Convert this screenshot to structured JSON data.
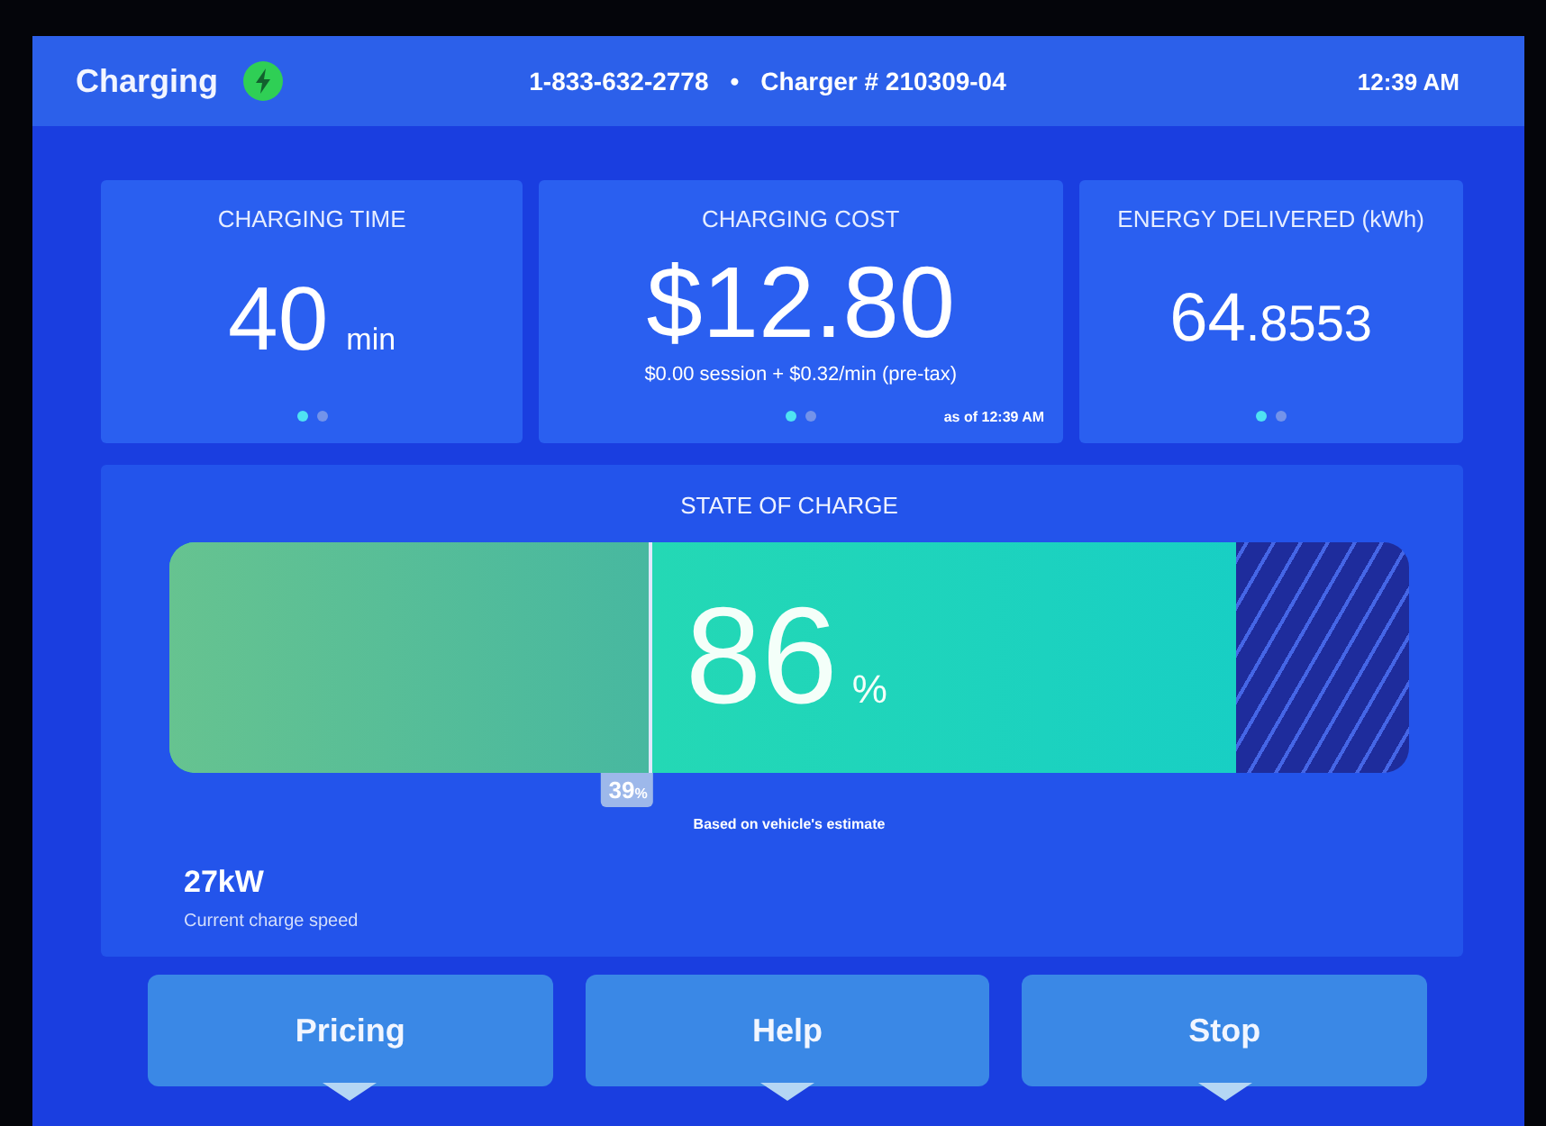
{
  "header": {
    "title": "Charging",
    "phone": "1-833-632-2778",
    "separator": "•",
    "charger": "Charger # 210309-04",
    "time": "12:39 AM"
  },
  "cards": [
    {
      "title": "CHARGING TIME",
      "value": "40",
      "unit": "min",
      "dots": [
        {
          "selected": true
        },
        {
          "selected": false
        }
      ]
    },
    {
      "title": "CHARGING COST",
      "value": "$12.80",
      "detail": "$0.00 session + $0.32/min (pre-tax)",
      "timestamp": "as of 12:39 AM",
      "dots": [
        {
          "selected": true
        },
        {
          "selected": false
        }
      ]
    },
    {
      "title": "ENERGY DELIVERED (kWh)",
      "value": "64",
      "value_fraction": ".8553",
      "dots": [
        {
          "selected": true
        },
        {
          "selected": false
        }
      ]
    }
  ],
  "state_of_charge": {
    "title": "STATE OF CHARGE",
    "level": 0.86,
    "value": "86",
    "unit": "%",
    "start": {
      "level": 0.39,
      "value": "39",
      "unit": "%"
    },
    "note": "Based on vehicle's estimate",
    "speed": "27kW",
    "speed_label": "Current charge speed"
  },
  "buttons": [
    {
      "label": "Pricing"
    },
    {
      "label": "Help"
    },
    {
      "label": "Stop"
    }
  ]
}
